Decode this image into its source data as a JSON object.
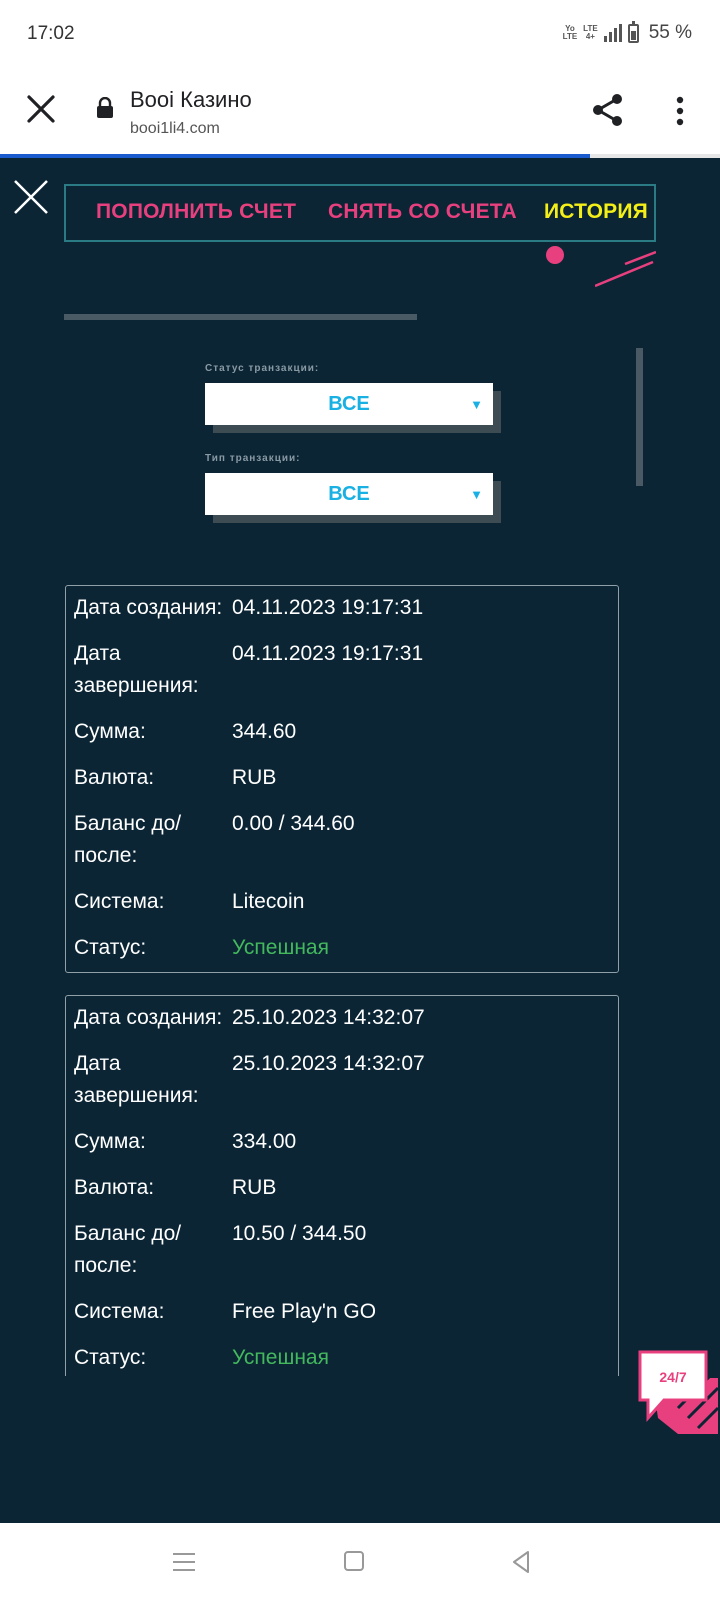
{
  "status_bar": {
    "time": "17:02",
    "network_top": "Yo",
    "network_bottom": "LTE",
    "lte_top": "LTE",
    "lte_bottom": "4+",
    "battery": "55 %"
  },
  "browser": {
    "title": "Booi Казино",
    "url": "booi1li4.com",
    "progress": 0.82
  },
  "tabs": {
    "deposit": "ПОПОЛНИТЬ СЧЕТ",
    "withdraw": "СНЯТЬ СО СЧЕТА",
    "history": "ИСТОРИЯ"
  },
  "filters": {
    "status_label": "Статус транзакции:",
    "status_value": "ВСЕ",
    "type_label": "Тип транзакции:",
    "type_value": "ВСЕ"
  },
  "transactions": [
    {
      "created_label": "Дата создания:",
      "created": "04.11.2023 19:17:31",
      "completed_label": "Дата завершения:",
      "completed": "04.11.2023 19:17:31",
      "amount_label": "Сумма:",
      "amount": "344.60",
      "currency_label": "Валюта:",
      "currency": "RUB",
      "balance_label": "Баланс до/ после:",
      "balance": "0.00 / 344.60",
      "system_label": "Система:",
      "system": "Litecoin",
      "status_label": "Статус:",
      "status": "Успешная"
    },
    {
      "created_label": "Дата создания:",
      "created": "25.10.2023 14:32:07",
      "completed_label": "Дата завершения:",
      "completed": "25.10.2023 14:32:07",
      "amount_label": "Сумма:",
      "amount": "334.00",
      "currency_label": "Валюта:",
      "currency": "RUB",
      "balance_label": "Баланс до/ после:",
      "balance": "10.50 / 344.50",
      "system_label": "Система:",
      "system": "Free Play'n GO",
      "status_label": "Статус:",
      "status": "Успешная"
    }
  ],
  "chat_badge": "24/7",
  "colors": {
    "page_bg": "#0b2535",
    "accent_pink": "#e8407e",
    "accent_yellow": "#f4ef16",
    "select_text": "#19b0e3",
    "success": "#43b85c"
  }
}
